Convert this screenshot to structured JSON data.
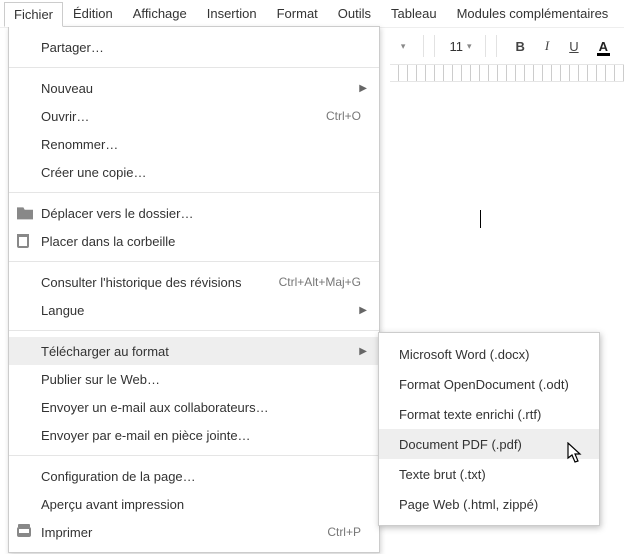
{
  "menubar": {
    "items": [
      {
        "label": "Fichier"
      },
      {
        "label": "Édition"
      },
      {
        "label": "Affichage"
      },
      {
        "label": "Insertion"
      },
      {
        "label": "Format"
      },
      {
        "label": "Outils"
      },
      {
        "label": "Tableau"
      },
      {
        "label": "Modules complémentaires"
      }
    ]
  },
  "toolbar": {
    "font_size": "11",
    "bold": "B",
    "italic": "I",
    "underline": "U",
    "text_color": "A"
  },
  "file_menu": {
    "share": "Partager…",
    "new": "Nouveau",
    "open": {
      "label": "Ouvrir…",
      "shortcut": "Ctrl+O"
    },
    "rename": "Renommer…",
    "make_copy": "Créer une copie…",
    "move": "Déplacer vers le dossier…",
    "trash": "Placer dans la corbeille",
    "revisions": {
      "label": "Consulter l'historique des révisions",
      "shortcut": "Ctrl+Alt+Maj+G"
    },
    "language": "Langue",
    "download": "Télécharger au format",
    "publish": "Publier sur le Web…",
    "email_collab": "Envoyer un e-mail aux collaborateurs…",
    "email_attach": "Envoyer par e-mail en pièce jointe…",
    "page_setup": "Configuration de la page…",
    "print_preview": "Aperçu avant impression",
    "print": {
      "label": "Imprimer",
      "shortcut": "Ctrl+P"
    }
  },
  "download_submenu": {
    "items": [
      "Microsoft Word (.docx)",
      "Format OpenDocument (.odt)",
      "Format texte enrichi (.rtf)",
      "Document PDF (.pdf)",
      "Texte brut (.txt)",
      "Page Web (.html, zippé)"
    ]
  }
}
